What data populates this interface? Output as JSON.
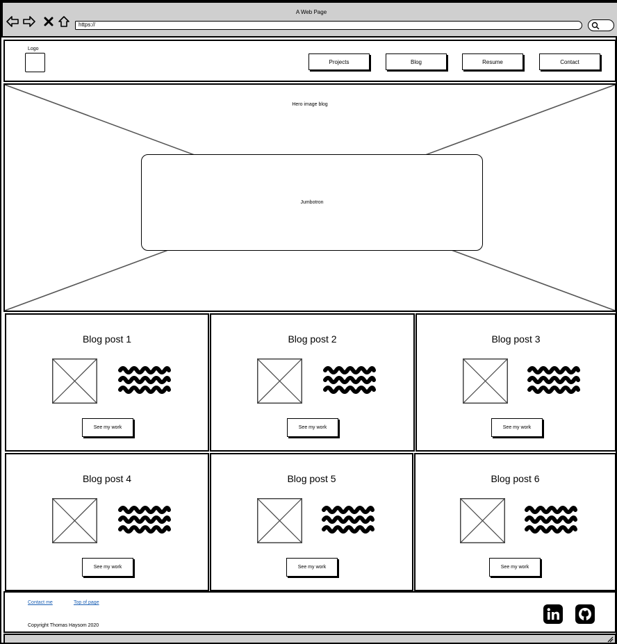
{
  "browser": {
    "title": "A Web Page",
    "url": "https://",
    "icons": [
      "back-arrow-icon",
      "forward-arrow-icon",
      "close-icon",
      "home-icon",
      "search-icon"
    ]
  },
  "header": {
    "logo_label": "Logo",
    "nav": [
      "Projects",
      "Blog",
      "Resume",
      "Contact"
    ]
  },
  "hero": {
    "label": "Hero image blog",
    "jumbotron": "Jumbotron"
  },
  "posts": [
    {
      "title": "Blog post 1",
      "button": "See my work"
    },
    {
      "title": "Blog post 2",
      "button": "See my work"
    },
    {
      "title": "Blog post 3",
      "button": "See my work"
    },
    {
      "title": "Blog post 4",
      "button": "See my work"
    },
    {
      "title": "Blog post 5",
      "button": "See my work"
    },
    {
      "title": "Blog post 6",
      "button": "See my work"
    }
  ],
  "footer": {
    "links": [
      "Contact me",
      "Top of page"
    ],
    "copyright": "Copyright Thomas Haysom 2020",
    "social": [
      "linkedin-icon",
      "github-icon"
    ],
    "link_color": "#1a5fb4"
  }
}
